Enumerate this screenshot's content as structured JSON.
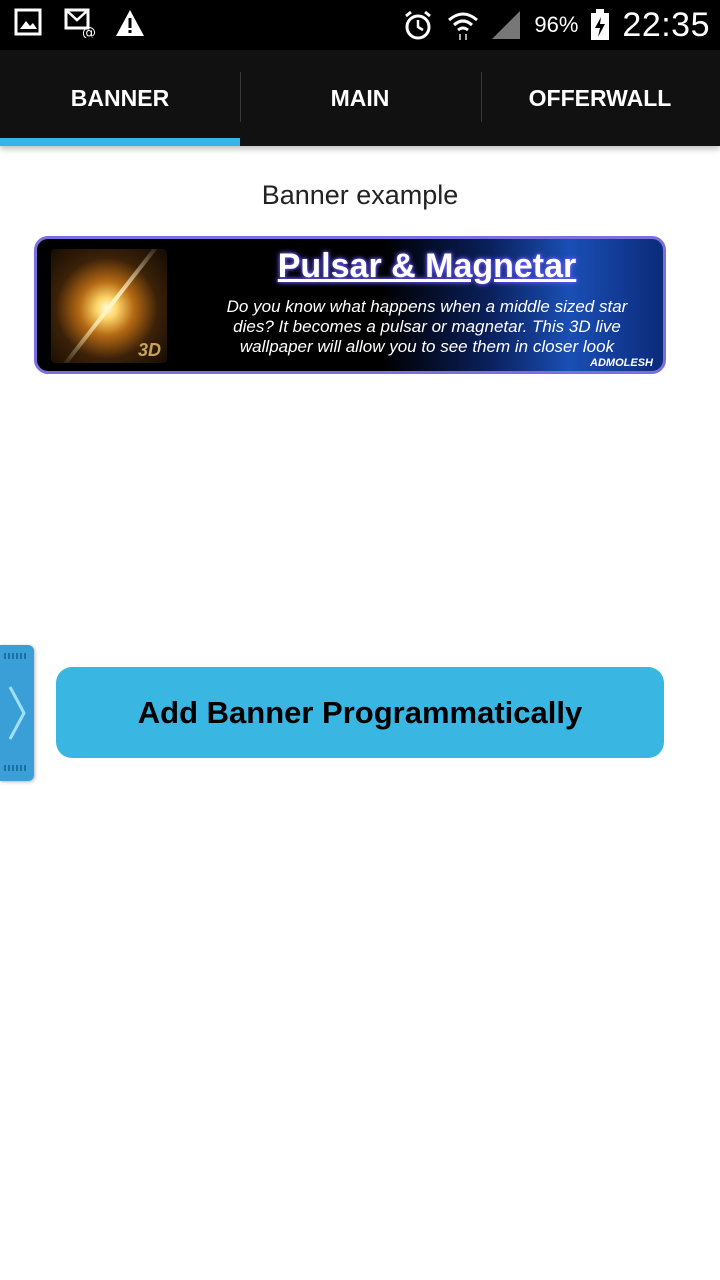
{
  "status_bar": {
    "battery_percent": "96%",
    "time": "22:35",
    "icons": [
      "gallery-icon",
      "email-icon",
      "warning-icon",
      "alarm-icon",
      "wifi-icon",
      "signal-icon",
      "battery-charging-icon"
    ]
  },
  "tabs": [
    {
      "label": "BANNER",
      "selected": true
    },
    {
      "label": "MAIN",
      "selected": false
    },
    {
      "label": "OFFERWALL",
      "selected": false
    }
  ],
  "content": {
    "heading": "Banner example",
    "ad": {
      "title": "Pulsar & Magnetar",
      "description": "Do you know what happens when a middle sized star dies? It becomes a pulsar or magnetar. This 3D live wallpaper will allow you to see them in closer look",
      "thumb_badge": "3D",
      "brand": "ADMOLESH"
    },
    "add_button_label": "Add Banner Programmatically"
  },
  "colors": {
    "accent": "#33b5e5",
    "button": "#39b6e1",
    "ad_border": "#7b6fe0",
    "tab_bar": "#111111"
  }
}
